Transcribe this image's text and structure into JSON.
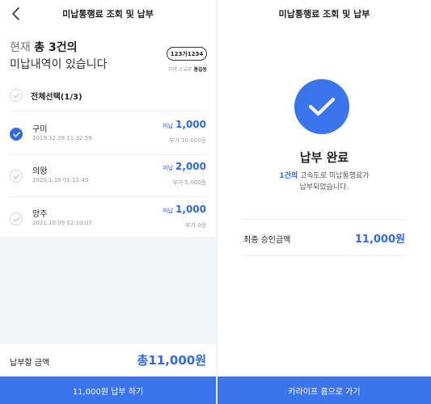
{
  "left": {
    "title": "미납통행료 조회 및 납부",
    "summary": {
      "prefix": "현재",
      "count_text": "총 3건의",
      "line2": "미납내역이 있습니다"
    },
    "plate": "123가1234",
    "owner_label": "차량 소유주",
    "owner_name": "홍길동",
    "select_all": "전체선택(1/3)",
    "items": [
      {
        "name": "구미",
        "date": "2019.12.29 11:32:59",
        "tag": "미납",
        "amount": "1,000",
        "extra": "부가 10,000원",
        "checked": true
      },
      {
        "name": "의왕",
        "date": "2020.1.19 01:12:49",
        "tag": "미납",
        "amount": "2,000",
        "extra": "부가 5,000원",
        "checked": false
      },
      {
        "name": "양주",
        "date": "2021.10.09 12:10:07",
        "tag": "미납",
        "amount": "1,000",
        "extra": "부가 0원",
        "checked": false
      }
    ],
    "total_label": "납부할 금액",
    "total_value": "총11,000원",
    "pay_button": "11,000원 납부 하기"
  },
  "right": {
    "title": "미납통행료 조회 및 납부",
    "done_title": "납부 완료",
    "msg_count": "1건의",
    "msg_rest": " 고속도로 미납통행료가",
    "msg_line2": "납부되었습니다.",
    "final_label": "최종 승인금액",
    "final_value": "11,000원",
    "home_button": "카라이프 홈으로 가기"
  },
  "colors": {
    "accent": "#3169e0",
    "button": "#3a75ee",
    "gray_bg": "#f4f5f7"
  },
  "icons": {
    "back": "chevron-left-icon",
    "check": "check-icon",
    "done": "check-circle-icon"
  }
}
